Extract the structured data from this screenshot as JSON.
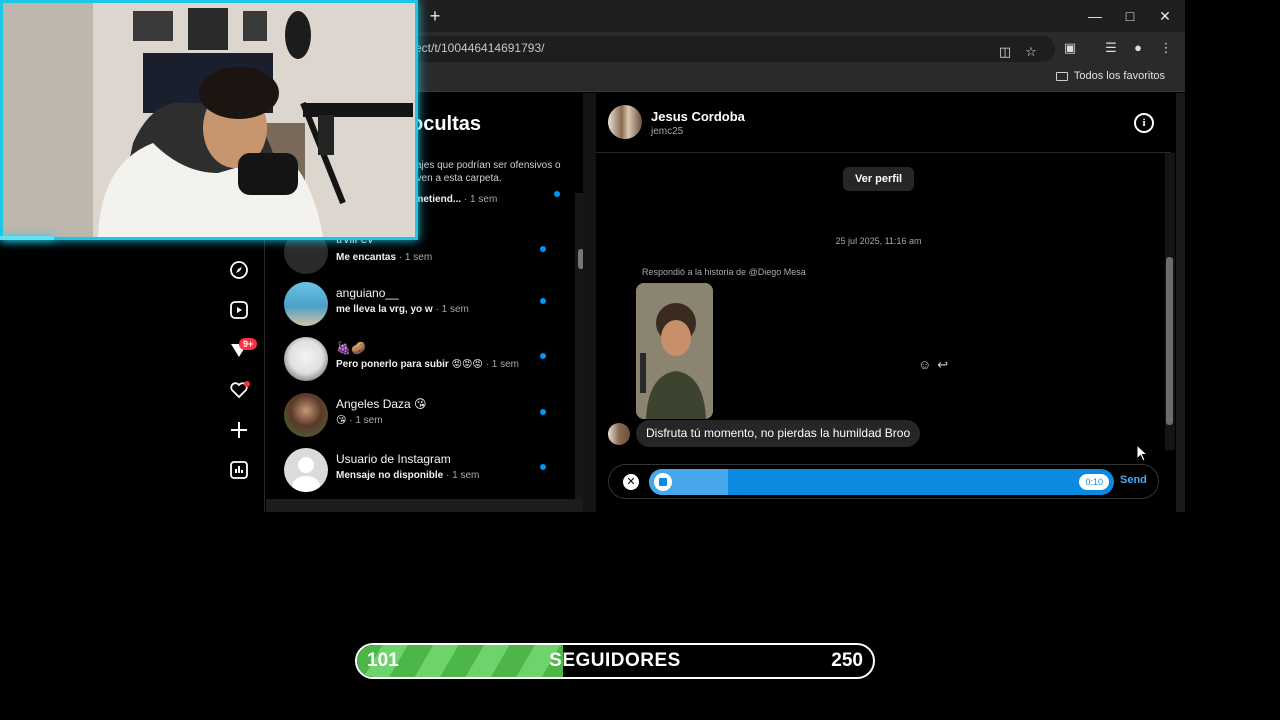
{
  "browser": {
    "url": "ect/t/100446414691793/",
    "bookmarks_label": "Todos los favoritos",
    "new_tab": "+"
  },
  "hidden_requests": {
    "title": "ocultas",
    "description": "sajes que podrían ser ofensivos o\neven a esta carpeta.",
    "partial_preview": "le estés metiend...",
    "partial_time": " · 1 sem",
    "partial_name": "trvlll ev",
    "conversations": [
      {
        "name": "",
        "preview": "Me encantas",
        "time": " · 1 sem",
        "unread": true
      },
      {
        "name": "anguiano__",
        "preview": "me lleva la vrg, yo w",
        "time": " · 1 sem",
        "unread": true
      },
      {
        "name": "🍇🥔",
        "preview": "Pero ponerlo para subir 😡😡😡",
        "time": " · 1 sem",
        "unread": true
      },
      {
        "name": "Angeles Daza 😘",
        "preview": "😘",
        "time": " · 1 sem",
        "unread": true
      },
      {
        "name": "Usuario de Instagram",
        "preview": "Mensaje no disponible",
        "time": " · 1 sem",
        "unread": true
      }
    ]
  },
  "rail": {
    "badge": "9+"
  },
  "chat": {
    "name": "Jesus Cordoba",
    "username": "jemc25",
    "view_profile": "Ver perfil",
    "date": "25 jul 2025, 11:16 am",
    "reply_label": "Respondió a la historia de @Diego Mesa",
    "message": "Disfruta tú momento, no pierdas la humildad Broo",
    "recording_time": "0:10",
    "recording_progress": 0.17,
    "send": "Send"
  },
  "followers": {
    "current": "101",
    "label": "SEGUIDORES",
    "goal": "250",
    "progress": 0.4
  },
  "colors": {
    "accent_blue": "#0095f6",
    "webcam_border": "#1cc6e6",
    "progress_green": "#4cb648"
  }
}
